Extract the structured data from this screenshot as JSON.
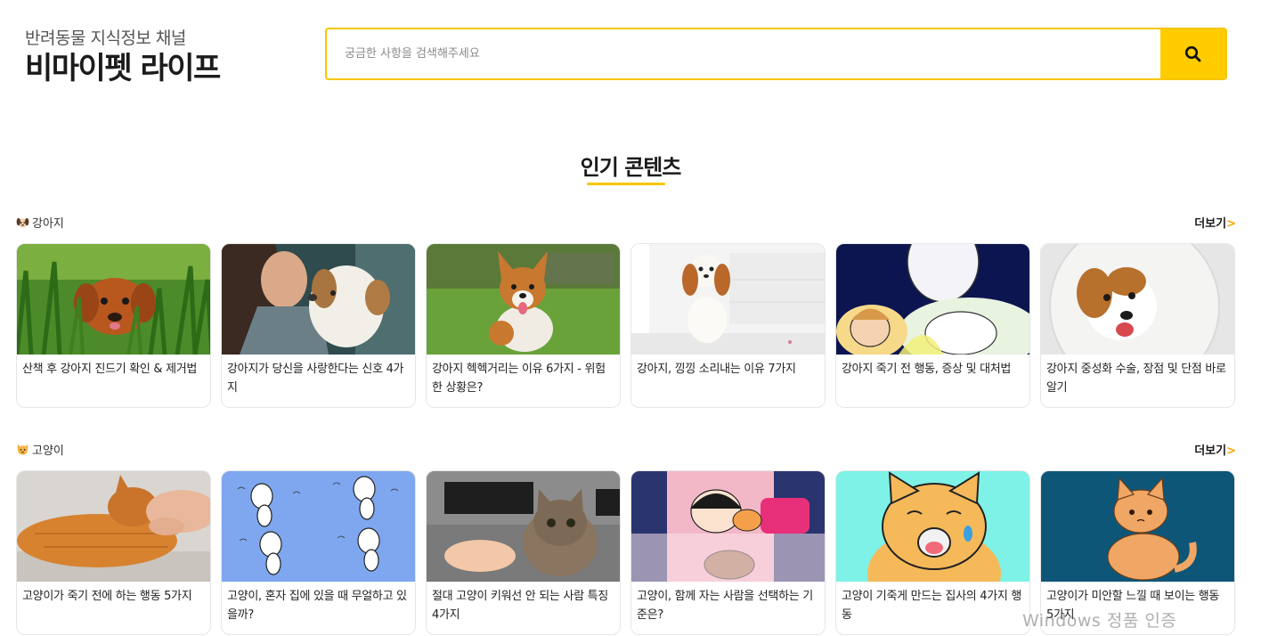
{
  "brand": {
    "subtitle": "반려동물 지식정보 채널",
    "title": "비마이펫 라이프"
  },
  "search": {
    "placeholder": "궁금한 사항을 검색해주세요",
    "icon": "search-icon"
  },
  "section": {
    "title": "인기 콘텐츠"
  },
  "categories": [
    {
      "label": "강아지",
      "icon": "dog-face-icon",
      "more": "더보기",
      "cards": [
        {
          "title": "산책 후 강아지 진드기 확인 & 제거법",
          "image": "puppy-in-grass"
        },
        {
          "title": "강아지가 당신을 사랑한다는 신호 4가지",
          "image": "woman-with-puppy"
        },
        {
          "title": "강아지 헥헥거리는 이유 6가지 - 위험한 상황은?",
          "image": "corgi-on-lawn"
        },
        {
          "title": "강아지, 낑낑 소리내는 이유 7가지",
          "image": "spaniel-indoors"
        },
        {
          "title": "강아지 죽기 전 행동, 증상 및 대처법",
          "image": "girl-and-dog-illustration"
        },
        {
          "title": "강아지 중성화 수술, 장점 및 단점 바로 알기",
          "image": "dog-with-cone-collar"
        }
      ]
    },
    {
      "label": "고양이",
      "icon": "cat-face-icon",
      "more": "더보기",
      "cards": [
        {
          "title": "고양이가 죽기 전에 하는 행동 5가지",
          "image": "orange-cat-petted"
        },
        {
          "title": "고양이, 혼자 집에 있을 때 무얼하고 있을까?",
          "image": "dancing-cats-illustration"
        },
        {
          "title": "절대 고양이 키워선 안 되는 사람 특징 4가지",
          "image": "kitten-on-hand"
        },
        {
          "title": "고양이, 함께 자는 사람을 선택하는 기준은?",
          "image": "girl-sleeping-with-cats"
        },
        {
          "title": "고양이 기죽게 만드는 집사의 4가지 행동",
          "image": "crying-cat-cartoon"
        },
        {
          "title": "고양이가 미안할 느낄 때 보이는 행동 5가지",
          "image": "sad-cat-cartoon"
        }
      ]
    }
  ],
  "watermark": "Windows 정품 인증",
  "colors": {
    "accent": "#ffcc00",
    "accent_border": "#f7c600",
    "more_chevron": "#f7a800"
  }
}
